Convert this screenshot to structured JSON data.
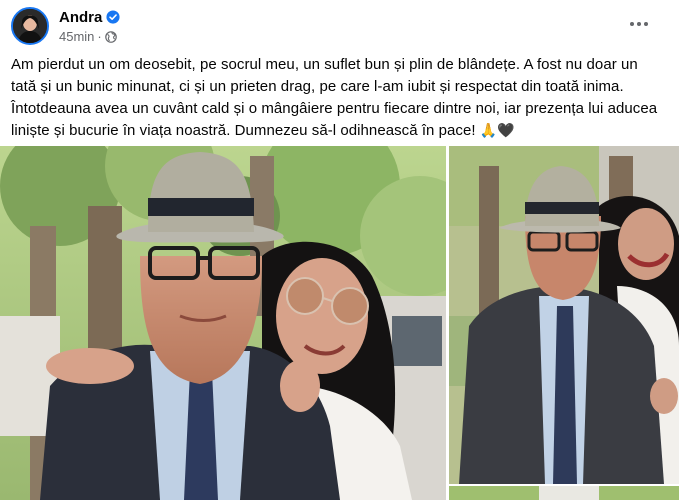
{
  "post": {
    "author": "Andra",
    "time": "45min",
    "separator": "·",
    "verified_icon": "verified-badge-icon",
    "privacy_icon": "globe-icon",
    "more_icon": "more-options-icon",
    "text_main": "Am pierdut un om deosebit, pe socrul meu, un suflet bun și plin de blândețe. A fost nu doar un tată și un bunic minunat, ci și un prieten drag, pe care l-am iubit și respectat din toată inima. Întotdeauna avea un cuvânt cald și o mângâiere pentru fiecare dintre noi, iar prezența lui aducea liniște și bucurie în viața noastră. Dumnezeu să-l odihnească în pace!",
    "emoji": "🙏🖤"
  },
  "colors": {
    "accent": "#1877f2",
    "secondary_text": "#65676b",
    "primary_text": "#050505"
  },
  "photos": [
    {
      "name": "photo-main"
    },
    {
      "name": "photo-side"
    },
    {
      "name": "photo-next"
    }
  ]
}
